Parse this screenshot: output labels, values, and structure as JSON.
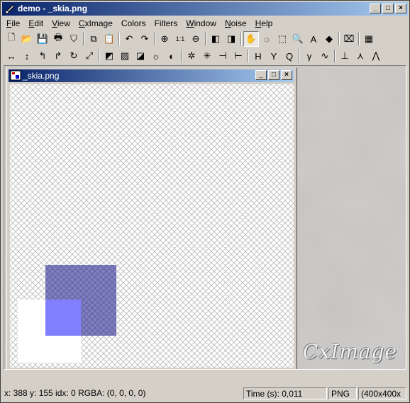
{
  "window": {
    "title": "demo - _skia.png"
  },
  "menu": [
    {
      "label": "File",
      "u": "F",
      "rest": "ile"
    },
    {
      "label": "Edit",
      "u": "E",
      "rest": "dit"
    },
    {
      "label": "View",
      "u": "V",
      "rest": "iew"
    },
    {
      "label": "CxImage",
      "u": "C",
      "rest": "xImage"
    },
    {
      "label": "Colors",
      "u": "",
      "rest": "Colors"
    },
    {
      "label": "Filters",
      "u": "",
      "rest": "Filters"
    },
    {
      "label": "Window",
      "u": "W",
      "rest": "indow"
    },
    {
      "label": "Noise",
      "u": "N",
      "rest": "oise"
    },
    {
      "label": "Help",
      "u": "H",
      "rest": "elp"
    }
  ],
  "toolbar1": [
    "new-icon",
    "open-icon",
    "save-icon",
    "print-icon",
    "filter-icon",
    "sep",
    "copy-icon",
    "paste-icon",
    "sep",
    "undo-icon",
    "redo-icon",
    "sep",
    "zoom-in-icon",
    "zoom-1to1-icon",
    "zoom-out-icon",
    "sep",
    "prev-frame-icon",
    "next-frame-icon",
    "sep",
    "hand-icon",
    "lasso-icon",
    "rect-select-icon",
    "magnifier-icon",
    "text-icon",
    "fill-icon",
    "sep",
    "crop-icon",
    "sep",
    "histogram-icon"
  ],
  "toolbar1_pressed": "hand-icon",
  "toolbar2": [
    "flip-h-icon",
    "flip-v-icon",
    "rotate-left-icon",
    "rotate-right-icon",
    "rotate-icon",
    "resize-icon",
    "sep",
    "negative-icon",
    "gray-icon",
    "threshold-icon",
    "brightness-icon",
    "contrast-icon",
    "sep",
    "erode-icon",
    "dilate-icon",
    "edge-icon",
    "contour-icon",
    "sep",
    "hsl-split-icon",
    "yuv-split-icon",
    "yiq-split-icon",
    "sep",
    "gamma-icon",
    "median-icon",
    "sep",
    "jitter-icon",
    "blur-icon",
    "sharpen-icon"
  ],
  "toolbar_glyphs": {
    "new-icon": "🗋",
    "open-icon": "📂",
    "save-icon": "💾",
    "print-icon": "🖶",
    "filter-icon": "⛉",
    "copy-icon": "⧉",
    "paste-icon": "📋",
    "undo-icon": "↶",
    "redo-icon": "↷",
    "zoom-in-icon": "⊕",
    "zoom-1to1-icon": "1:1",
    "zoom-out-icon": "⊖",
    "prev-frame-icon": "◧",
    "next-frame-icon": "◨",
    "hand-icon": "✋",
    "lasso-icon": "◌",
    "rect-select-icon": "⬚",
    "magnifier-icon": "🔍",
    "text-icon": "A",
    "fill-icon": "◆",
    "crop-icon": "⌧",
    "histogram-icon": "▦",
    "flip-h-icon": "↔",
    "flip-v-icon": "↕",
    "rotate-left-icon": "↰",
    "rotate-right-icon": "↱",
    "rotate-icon": "↻",
    "resize-icon": "⤢",
    "negative-icon": "◩",
    "gray-icon": "▨",
    "threshold-icon": "◪",
    "brightness-icon": "☼",
    "contrast-icon": "◐",
    "erode-icon": "✲",
    "dilate-icon": "✳",
    "edge-icon": "⊣",
    "contour-icon": "⊢",
    "hsl-split-icon": "H",
    "yuv-split-icon": "Y",
    "yiq-split-icon": "Q",
    "gamma-icon": "γ",
    "median-icon": "∿",
    "jitter-icon": "⊥",
    "blur-icon": "⋏",
    "sharpen-icon": "⋀"
  },
  "child": {
    "title": "_skia.png"
  },
  "logo": "CxImage",
  "image": {
    "checker_light": "#ffffff",
    "checker_dark": "#c0c0c0",
    "white_square": "#ffffff",
    "blue_square": "#00008b",
    "blue_alpha": 0.5,
    "overlap": "#8080ff"
  },
  "status": {
    "coords": "x: 388 y: 155  idx: 0  RGBA: (0, 0, 0, 0)",
    "time": "Time (s): 0,011",
    "format": "PNG",
    "size": "(400x400x"
  }
}
